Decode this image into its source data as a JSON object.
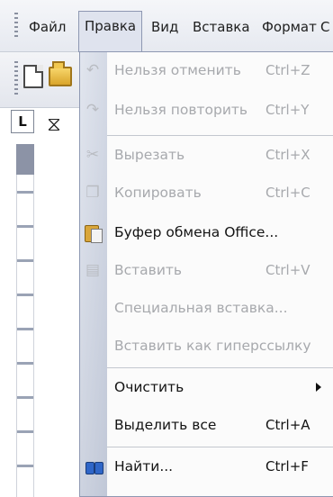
{
  "menubar": {
    "items": [
      {
        "label": "Файл"
      },
      {
        "label": "Правка"
      },
      {
        "label": "Вид"
      },
      {
        "label": "Вставка"
      },
      {
        "label": "Формат"
      },
      {
        "label": "С"
      }
    ]
  },
  "toolbar": {
    "icons": [
      "new-document-icon",
      "open-folder-icon"
    ]
  },
  "left_pane": {
    "ruler_corner": "L"
  },
  "edit_menu": {
    "items": [
      {
        "label": "Нельзя отменить",
        "shortcut": "Ctrl+Z",
        "enabled": false,
        "icon": "undo-icon"
      },
      {
        "label": "Нельзя повторить",
        "shortcut": "Ctrl+Y",
        "enabled": false,
        "icon": "redo-icon"
      },
      {
        "label": "Вырезать",
        "shortcut": "Ctrl+X",
        "enabled": false,
        "icon": "scissors-icon"
      },
      {
        "label": "Копировать",
        "shortcut": "Ctrl+C",
        "enabled": false,
        "icon": "copy-icon"
      },
      {
        "label": "Буфер обмена Office...",
        "shortcut": "",
        "enabled": true,
        "icon": "clipboard-icon"
      },
      {
        "label": "Вставить",
        "shortcut": "Ctrl+V",
        "enabled": false,
        "icon": "paste-icon"
      },
      {
        "label": "Специальная вставка...",
        "shortcut": "",
        "enabled": false,
        "icon": ""
      },
      {
        "label": "Вставить как гиперссылку",
        "shortcut": "",
        "enabled": false,
        "icon": ""
      },
      {
        "label": "Очистить",
        "shortcut": "",
        "enabled": true,
        "submenu": true,
        "icon": ""
      },
      {
        "label": "Выделить все",
        "shortcut": "Ctrl+A",
        "enabled": true,
        "icon": ""
      },
      {
        "label": "Найти...",
        "shortcut": "Ctrl+F",
        "enabled": true,
        "icon": "binoculars-icon"
      }
    ]
  },
  "colors": {
    "menu_border": "#8e98b2",
    "disabled_text": "#a7a9ad",
    "enabled_text": "#141414",
    "gutter": "#c9cfdd"
  }
}
